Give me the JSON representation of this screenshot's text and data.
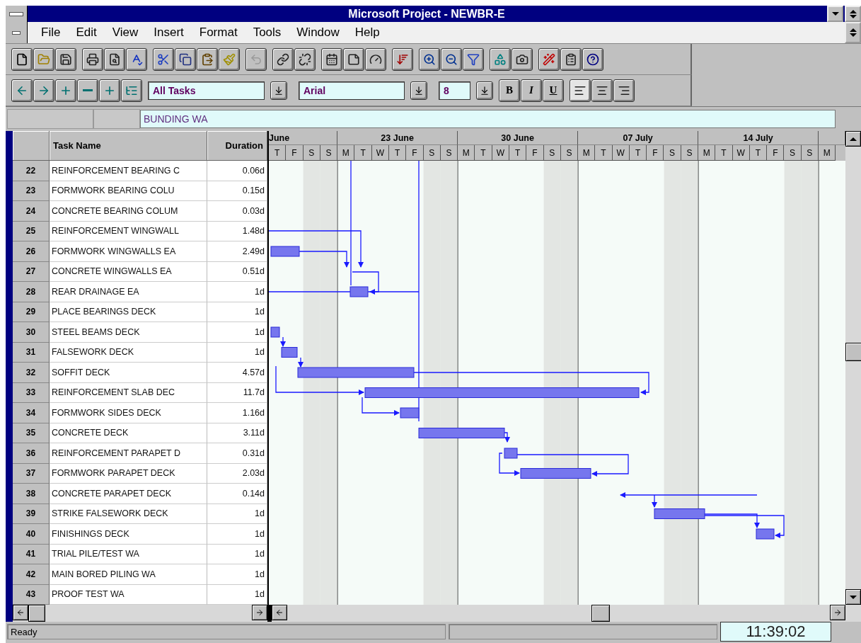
{
  "window": {
    "title": "Microsoft Project - NEWBR-E"
  },
  "menu": [
    "File",
    "Edit",
    "View",
    "Insert",
    "Format",
    "Tools",
    "Window",
    "Help"
  ],
  "standard_toolbar": [
    [
      {
        "kind": "new",
        "disabled": false
      },
      {
        "kind": "open",
        "disabled": false
      },
      {
        "kind": "save",
        "disabled": false
      }
    ],
    [
      {
        "kind": "print",
        "disabled": false
      },
      {
        "kind": "preview",
        "disabled": false
      },
      {
        "kind": "spelling",
        "disabled": false
      }
    ],
    [
      {
        "kind": "cut",
        "disabled": false
      },
      {
        "kind": "copy",
        "disabled": false
      },
      {
        "kind": "paste",
        "disabled": false
      },
      {
        "kind": "painter",
        "disabled": false
      }
    ],
    [
      {
        "kind": "undo",
        "disabled": true
      }
    ],
    [
      {
        "kind": "link",
        "disabled": false
      },
      {
        "kind": "unlink",
        "disabled": false
      }
    ],
    [
      {
        "kind": "info",
        "disabled": false
      },
      {
        "kind": "note",
        "disabled": false
      },
      {
        "kind": "wizard",
        "disabled": false
      }
    ],
    [
      {
        "kind": "sort",
        "disabled": false
      }
    ],
    [
      {
        "kind": "zoom-in",
        "disabled": false
      },
      {
        "kind": "zoom-out",
        "disabled": false
      },
      {
        "kind": "goto",
        "disabled": false
      }
    ],
    [
      {
        "kind": "shapes",
        "disabled": false
      },
      {
        "kind": "camera",
        "disabled": false
      }
    ],
    [
      {
        "kind": "wand",
        "disabled": false
      },
      {
        "kind": "form",
        "disabled": false
      },
      {
        "kind": "help",
        "disabled": false
      }
    ]
  ],
  "outline_toolbar": [
    {
      "kind": "outdent"
    },
    {
      "kind": "indent"
    },
    {
      "kind": "show"
    },
    {
      "kind": "hide"
    },
    {
      "kind": "show-all"
    },
    {
      "kind": "options"
    }
  ],
  "formatting": {
    "filter": "All Tasks",
    "font": "Arial",
    "size": "8",
    "styles": [
      "B",
      "I",
      "U"
    ],
    "align": [
      {
        "kind": "left",
        "selected": true
      },
      {
        "kind": "center",
        "selected": false
      },
      {
        "kind": "right",
        "selected": false
      }
    ]
  },
  "entry_bar": {
    "value": "BUNDING WA"
  },
  "table": {
    "columns": [
      "Task Name",
      "Duration"
    ],
    "rows": [
      {
        "id": "22",
        "name": "REINFORCEMENT BEARING C",
        "duration": "0.06d"
      },
      {
        "id": "23",
        "name": "FORMWORK BEARING COLU",
        "duration": "0.15d"
      },
      {
        "id": "24",
        "name": "CONCRETE BEARING COLUM",
        "duration": "0.03d"
      },
      {
        "id": "25",
        "name": "REINFORCEMENT WINGWALL",
        "duration": "1.48d"
      },
      {
        "id": "26",
        "name": "FORMWORK WINGWALLS EA",
        "duration": "2.49d"
      },
      {
        "id": "27",
        "name": "CONCRETE WINGWALLS EA",
        "duration": "0.51d"
      },
      {
        "id": "28",
        "name": "REAR DRAINAGE EA",
        "duration": "1d"
      },
      {
        "id": "29",
        "name": "PLACE BEARINGS DECK",
        "duration": "1d"
      },
      {
        "id": "30",
        "name": "STEEL BEAMS DECK",
        "duration": "1d"
      },
      {
        "id": "31",
        "name": "FALSEWORK DECK",
        "duration": "1d"
      },
      {
        "id": "32",
        "name": "SOFFIT DECK",
        "duration": "4.57d"
      },
      {
        "id": "33",
        "name": "REINFORCEMENT SLAB DEC",
        "duration": "11.7d"
      },
      {
        "id": "34",
        "name": "FORMWORK SIDES DECK",
        "duration": "1.16d"
      },
      {
        "id": "35",
        "name": "CONCRETE DECK",
        "duration": "3.11d"
      },
      {
        "id": "36",
        "name": "REINFORCEMENT PARAPET D",
        "duration": "0.31d"
      },
      {
        "id": "37",
        "name": "FORMWORK PARAPET DECK",
        "duration": "2.03d"
      },
      {
        "id": "38",
        "name": "CONCRETE PARAPET DECK",
        "duration": "0.14d"
      },
      {
        "id": "39",
        "name": "STRIKE FALSEWORK DECK",
        "duration": "1d"
      },
      {
        "id": "40",
        "name": "FINISHINGS DECK",
        "duration": "1d"
      },
      {
        "id": "41",
        "name": "TRIAL PILE/TEST WA",
        "duration": "1d"
      },
      {
        "id": "42",
        "name": "MAIN BORED PILING WA",
        "duration": "1d"
      },
      {
        "id": "43",
        "name": "PROOF TEST WA",
        "duration": "1d"
      }
    ]
  },
  "timescale": {
    "weeks": [
      "June",
      "23 June",
      "30 June",
      "07 July",
      "14 July"
    ],
    "days": [
      {
        "label": "T",
        "weekend": false
      },
      {
        "label": "F",
        "weekend": false
      },
      {
        "label": "S",
        "weekend": true
      },
      {
        "label": "S",
        "weekend": true
      },
      {
        "label": "M",
        "weekend": false
      },
      {
        "label": "T",
        "weekend": false
      },
      {
        "label": "W",
        "weekend": false
      },
      {
        "label": "T",
        "weekend": false
      },
      {
        "label": "F",
        "weekend": false
      },
      {
        "label": "S",
        "weekend": true
      },
      {
        "label": "S",
        "weekend": true
      },
      {
        "label": "M",
        "weekend": false
      },
      {
        "label": "T",
        "weekend": false
      },
      {
        "label": "W",
        "weekend": false
      },
      {
        "label": "T",
        "weekend": false
      },
      {
        "label": "F",
        "weekend": false
      },
      {
        "label": "S",
        "weekend": true
      },
      {
        "label": "S",
        "weekend": true
      },
      {
        "label": "M",
        "weekend": false
      },
      {
        "label": "T",
        "weekend": false
      },
      {
        "label": "W",
        "weekend": false
      },
      {
        "label": "T",
        "weekend": false
      },
      {
        "label": "F",
        "weekend": false
      },
      {
        "label": "S",
        "weekend": true
      },
      {
        "label": "S",
        "weekend": true
      },
      {
        "label": "M",
        "weekend": false
      },
      {
        "label": "T",
        "weekend": false
      },
      {
        "label": "W",
        "weekend": false
      },
      {
        "label": "T",
        "weekend": false
      },
      {
        "label": "F",
        "weekend": false
      },
      {
        "label": "S",
        "weekend": true
      },
      {
        "label": "S",
        "weekend": true
      },
      {
        "label": "M",
        "weekend": false
      }
    ]
  },
  "status_bar": {
    "message": "Ready",
    "time": "11:39:02"
  }
}
